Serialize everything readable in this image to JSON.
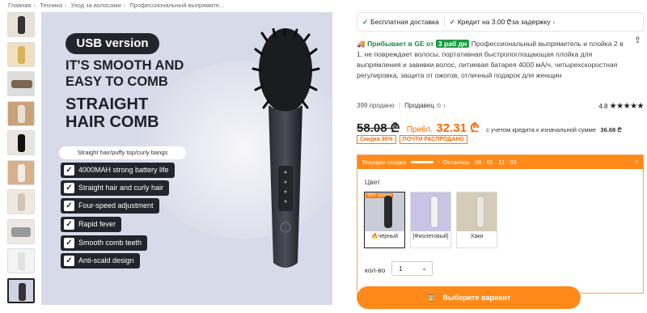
{
  "breadcrumbs": [
    "Главная",
    "Техника",
    "Уход за волосами",
    "Профессиональный выпрямите..."
  ],
  "product_image": {
    "usb_label": "USB version",
    "headline": "IT'S SMOOTH AND EASY TO COMB",
    "headline2": "STRAIGHT HAIR COMB",
    "subtitle": "Straight hair/puffy top/curly bangs",
    "features": [
      "4000MAH strong battery life",
      "Straight hair and curly hair",
      "Four-speed adjustment",
      "Rapid fever",
      "Smooth comb teeth",
      "Anti-scald design"
    ]
  },
  "topbar": {
    "free_delivery": "Бесплатная доставка",
    "credit": "Кредит на 3.00",
    "credit_symbol": "₾",
    "credit_suffix": " за задержку"
  },
  "delivery": {
    "prefix": "Прибывает в GE от",
    "days": "3 раб дн"
  },
  "title": "Профессиональный выпрямитель и плойка 2 в 1, не повреждает волосы, портативная быстропоглощающая плойка для выпрямления и завивки волос, литиевая батарея 4000 мА/ч, четырехскоростная регулировка, защита от ожогов, отличный подарок для женщин",
  "stats": {
    "sold": "399 продано",
    "seller": "Продавец",
    "rating": "4.8",
    "stars": "★★★★★"
  },
  "price": {
    "old": "58.08 ₾",
    "approx": "Прибл.",
    "new": "32.31 ₾",
    "credit_note": "с учетом кредита к изначальной сумме",
    "credit_amount": "36.68 ₾"
  },
  "badges": [
    "Скидка 36%",
    "ПОЧТИ РАСПРОДАНО"
  ],
  "sale": {
    "label": "Текущая скидка",
    "remaining": "Осталось",
    "time": "06 : 01 : 11 : 33"
  },
  "colors": {
    "label": "Цвет",
    "tag": "99% купили",
    "options": [
      {
        "name": "чёрный",
        "accent": "#2a2a2a",
        "bg": "#c9ccd6"
      },
      {
        "name": "[Фиолетовый]",
        "accent": "#f2f2f2",
        "bg": "#c9c3e6"
      },
      {
        "name": "Хаки",
        "accent": "#ece7dd",
        "bg": "#d6cbb9"
      }
    ]
  },
  "quantity": {
    "label": "кол-во",
    "value": "1"
  },
  "cta": {
    "label": "Выберите вариант"
  },
  "colors_brand": {
    "orange": "#ff8a1a",
    "green": "#1a9a40"
  }
}
